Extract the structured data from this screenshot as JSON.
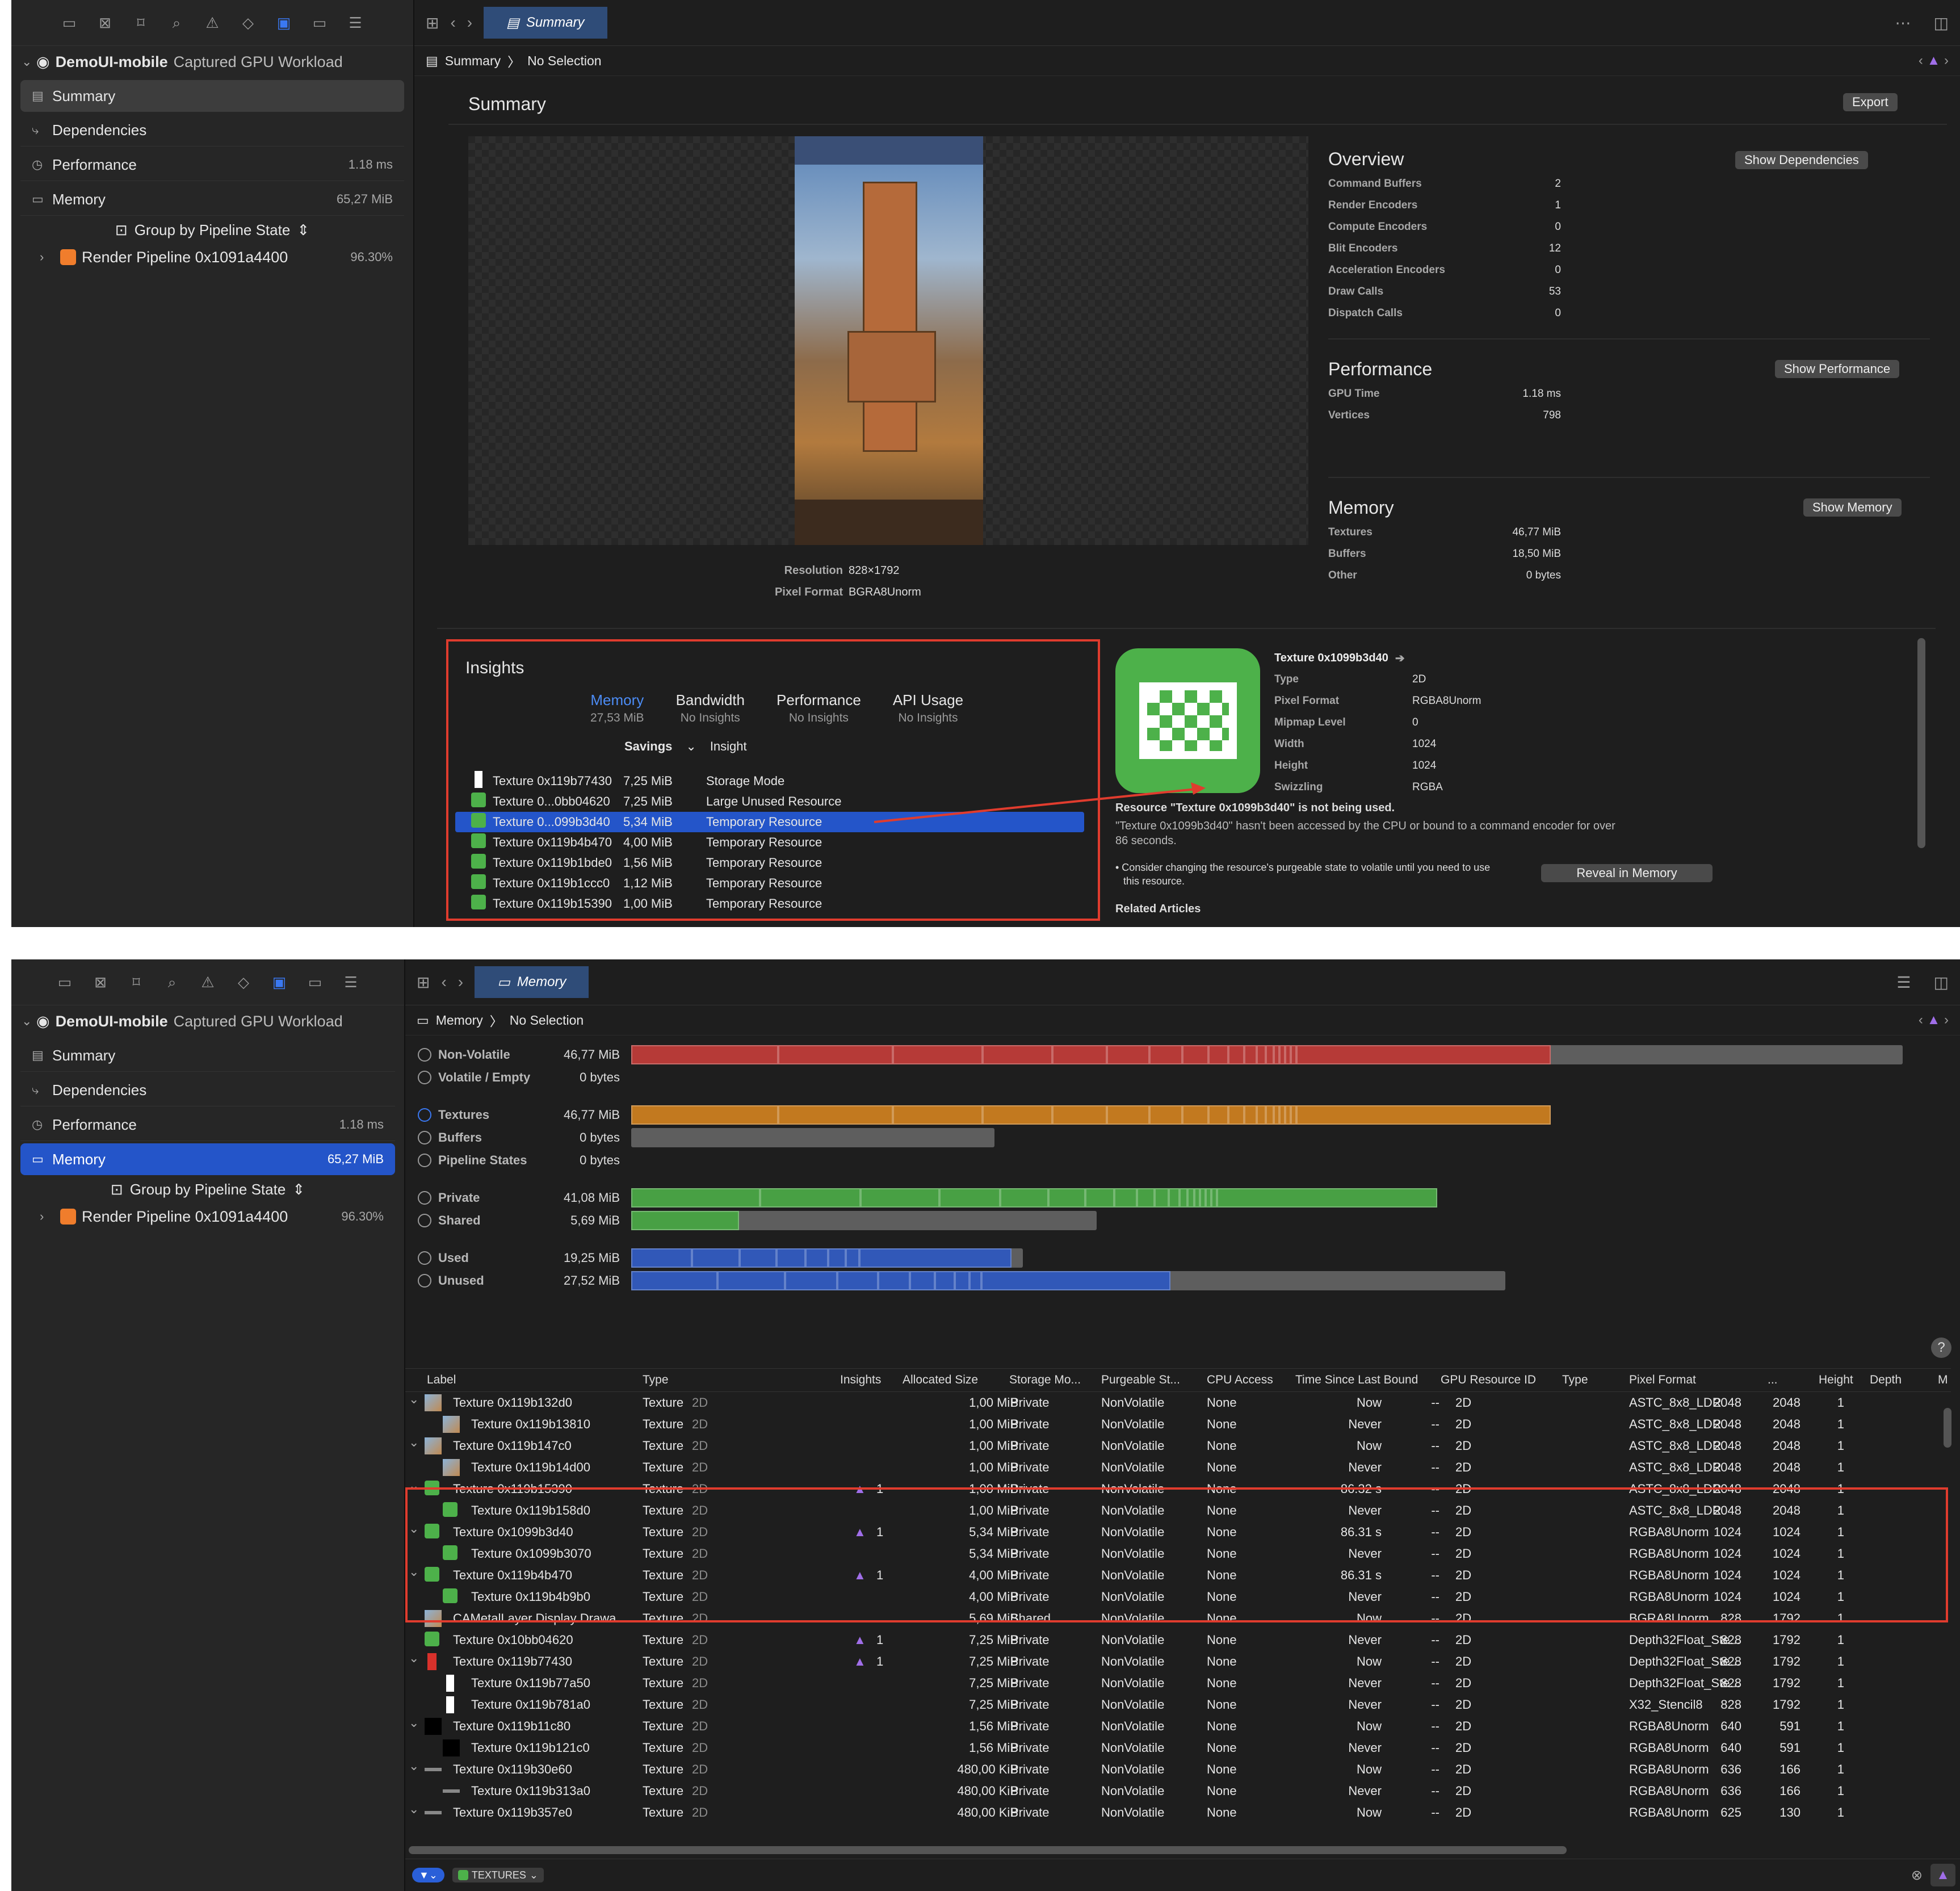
{
  "sidebar": {
    "toolbar_icons": [
      "folder-icon",
      "x-square-icon",
      "bookmark-icon",
      "search-icon",
      "warning-icon",
      "diamond-icon",
      "gpu-icon",
      "rectangle-icon",
      "list-icon"
    ],
    "app_name": "DemoUI-mobile",
    "app_sub": "Captured GPU Workload",
    "items": [
      {
        "label": "Summary",
        "value": ""
      },
      {
        "label": "Dependencies",
        "value": ""
      },
      {
        "label": "Performance",
        "value": "1.18 ms"
      },
      {
        "label": "Memory",
        "value": "65,27 MiB"
      }
    ],
    "group_label": "Group by Pipeline State",
    "pipeline_label": "Render Pipeline 0x1091a4400",
    "pipeline_value": "96.30%"
  },
  "top": {
    "tab_label": "Summary",
    "crumb_root": "Summary",
    "crumb_sel": "No Selection",
    "title": "Summary",
    "export": "Export",
    "resolution_k": "Resolution",
    "resolution_v": "828×1792",
    "pixelformat_k": "Pixel Format",
    "pixelformat_v": "BGRA8Unorm",
    "overview": {
      "title": "Overview",
      "button": "Show Dependencies",
      "rows": [
        {
          "k": "Command Buffers",
          "v": "2"
        },
        {
          "k": "Render Encoders",
          "v": "1"
        },
        {
          "k": "Compute Encoders",
          "v": "0"
        },
        {
          "k": "Blit Encoders",
          "v": "12"
        },
        {
          "k": "Acceleration Encoders",
          "v": "0"
        },
        {
          "k": "Draw Calls",
          "v": "53"
        },
        {
          "k": "Dispatch Calls",
          "v": "0"
        }
      ]
    },
    "performance": {
      "title": "Performance",
      "button": "Show Performance",
      "rows": [
        {
          "k": "GPU Time",
          "v": "1.18 ms"
        },
        {
          "k": "Vertices",
          "v": "798"
        }
      ]
    },
    "memory": {
      "title": "Memory",
      "button": "Show Memory",
      "rows": [
        {
          "k": "Textures",
          "v": "46,77 MiB"
        },
        {
          "k": "Buffers",
          "v": "18,50 MiB"
        },
        {
          "k": "Other",
          "v": "0 bytes"
        }
      ]
    },
    "insights": {
      "title": "Insights",
      "tabs": [
        {
          "name": "Memory",
          "sub": "27,53 MiB"
        },
        {
          "name": "Bandwidth",
          "sub": "No Insights"
        },
        {
          "name": "Performance",
          "sub": "No Insights"
        },
        {
          "name": "API Usage",
          "sub": "No Insights"
        }
      ],
      "col_savings": "Savings",
      "col_insight": "Insight",
      "rows": [
        {
          "icon": "white",
          "name": "Texture 0x119b77430",
          "size": "7,25 MiB",
          "insight": "Storage Mode"
        },
        {
          "icon": "green",
          "name": "Texture 0...0bb04620",
          "size": "7,25 MiB",
          "insight": "Large Unused Resource"
        },
        {
          "icon": "green",
          "name": "Texture 0...099b3d40",
          "size": "5,34 MiB",
          "insight": "Temporary Resource"
        },
        {
          "icon": "green",
          "name": "Texture 0x119b4b470",
          "size": "4,00 MiB",
          "insight": "Temporary Resource"
        },
        {
          "icon": "green",
          "name": "Texture 0x119b1bde0",
          "size": "1,56 MiB",
          "insight": "Temporary Resource"
        },
        {
          "icon": "green",
          "name": "Texture 0x119b1ccc0",
          "size": "1,12 MiB",
          "insight": "Temporary Resource"
        },
        {
          "icon": "green",
          "name": "Texture 0x119b15390",
          "size": "1,00 MiB",
          "insight": "Temporary Resource"
        }
      ]
    },
    "detail": {
      "title": "Texture 0x1099b3d40",
      "rows": [
        {
          "k": "Type",
          "v": "2D"
        },
        {
          "k": "Pixel Format",
          "v": "RGBA8Unorm"
        },
        {
          "k": "Mipmap Level",
          "v": "0"
        },
        {
          "k": "Width",
          "v": "1024"
        },
        {
          "k": "Height",
          "v": "1024"
        },
        {
          "k": "Swizzling",
          "v": "RGBA"
        }
      ],
      "headline": "Resource \"Texture 0x1099b3d40\" is not being used.",
      "desc1": "\"Texture 0x1099b3d40\" hasn't been accessed by the CPU or bound to a command encoder for over",
      "desc2": "86 seconds.",
      "tip1": "• Consider changing the resource's purgeable state to volatile until you need to use",
      "tip2": "this resource.",
      "reveal": "Reveal in Memory",
      "related": "Related Articles"
    }
  },
  "bottom": {
    "tab_label": "Memory",
    "crumb_root": "Memory",
    "crumb_sel": "No Selection",
    "bars": [
      {
        "label": "Non-Volatile",
        "value": "46,77 MiB"
      },
      {
        "label": "Volatile / Empty",
        "value": "0 bytes"
      },
      {
        "label": "Textures",
        "value": "46,77 MiB"
      },
      {
        "label": "Buffers",
        "value": "0 bytes"
      },
      {
        "label": "Pipeline States",
        "value": "0 bytes"
      },
      {
        "label": "Private",
        "value": "41,08 MiB"
      },
      {
        "label": "Shared",
        "value": "5,69 MiB"
      },
      {
        "label": "Used",
        "value": "19,25 MiB"
      },
      {
        "label": "Unused",
        "value": "27,52 MiB"
      }
    ],
    "help": "?",
    "columns": [
      "Label",
      "Type",
      "Insights",
      "Allocated Size",
      "Storage Mo...",
      "Purgeable St...",
      "CPU Access",
      "Time Since Last Bound",
      "GPU Resource ID",
      "Type",
      "Pixel Format",
      "...",
      "Height",
      "Depth",
      "M"
    ],
    "rows": [
      {
        "lvl": 0,
        "exp": true,
        "icon": "photo",
        "label": "Texture 0x119b132d0",
        "type": "Texture",
        "type2": "2D",
        "ins": "",
        "size": "1,00 MiB",
        "storage": "Private",
        "purg": "NonVolatile",
        "cpu": "None",
        "tslb": "Now",
        "gid": "--",
        "t": "2D",
        "fmt": "ASTC_8x8_LDR",
        "w": "2048",
        "h": "2048",
        "d": "1"
      },
      {
        "lvl": 1,
        "exp": false,
        "icon": "photo",
        "label": "Texture 0x119b13810",
        "type": "Texture",
        "type2": "2D",
        "ins": "",
        "size": "1,00 MiB",
        "storage": "Private",
        "purg": "NonVolatile",
        "cpu": "None",
        "tslb": "Never",
        "gid": "--",
        "t": "2D",
        "fmt": "ASTC_8x8_LDR",
        "w": "2048",
        "h": "2048",
        "d": "1"
      },
      {
        "lvl": 0,
        "exp": true,
        "icon": "photo",
        "label": "Texture 0x119b147c0",
        "type": "Texture",
        "type2": "2D",
        "ins": "",
        "size": "1,00 MiB",
        "storage": "Private",
        "purg": "NonVolatile",
        "cpu": "None",
        "tslb": "Now",
        "gid": "--",
        "t": "2D",
        "fmt": "ASTC_8x8_LDR",
        "w": "2048",
        "h": "2048",
        "d": "1"
      },
      {
        "lvl": 1,
        "exp": false,
        "icon": "photo",
        "label": "Texture 0x119b14d00",
        "type": "Texture",
        "type2": "2D",
        "ins": "",
        "size": "1,00 MiB",
        "storage": "Private",
        "purg": "NonVolatile",
        "cpu": "None",
        "tslb": "Never",
        "gid": "--",
        "t": "2D",
        "fmt": "ASTC_8x8_LDR",
        "w": "2048",
        "h": "2048",
        "d": "1"
      },
      {
        "lvl": 0,
        "exp": true,
        "icon": "green",
        "label": "Texture 0x119b15390",
        "type": "Texture",
        "type2": "2D",
        "ins": "1",
        "size": "1,00 MiB",
        "storage": "Private",
        "purg": "NonVolatile",
        "cpu": "None",
        "tslb": "86.32 s",
        "gid": "--",
        "t": "2D",
        "fmt": "ASTC_8x8_LDR",
        "w": "2048",
        "h": "2048",
        "d": "1"
      },
      {
        "lvl": 1,
        "exp": false,
        "icon": "green",
        "label": "Texture 0x119b158d0",
        "type": "Texture",
        "type2": "2D",
        "ins": "",
        "size": "1,00 MiB",
        "storage": "Private",
        "purg": "NonVolatile",
        "cpu": "None",
        "tslb": "Never",
        "gid": "--",
        "t": "2D",
        "fmt": "ASTC_8x8_LDR",
        "w": "2048",
        "h": "2048",
        "d": "1"
      },
      {
        "lvl": 0,
        "exp": true,
        "icon": "green",
        "label": "Texture 0x1099b3d40",
        "type": "Texture",
        "type2": "2D",
        "ins": "1",
        "size": "5,34 MiB",
        "storage": "Private",
        "purg": "NonVolatile",
        "cpu": "None",
        "tslb": "86.31 s",
        "gid": "--",
        "t": "2D",
        "fmt": "RGBA8Unorm",
        "w": "1024",
        "h": "1024",
        "d": "1"
      },
      {
        "lvl": 1,
        "exp": false,
        "icon": "green",
        "label": "Texture 0x1099b3070",
        "type": "Texture",
        "type2": "2D",
        "ins": "",
        "size": "5,34 MiB",
        "storage": "Private",
        "purg": "NonVolatile",
        "cpu": "None",
        "tslb": "Never",
        "gid": "--",
        "t": "2D",
        "fmt": "RGBA8Unorm",
        "w": "1024",
        "h": "1024",
        "d": "1"
      },
      {
        "lvl": 0,
        "exp": true,
        "icon": "green",
        "label": "Texture 0x119b4b470",
        "type": "Texture",
        "type2": "2D",
        "ins": "1",
        "size": "4,00 MiB",
        "storage": "Private",
        "purg": "NonVolatile",
        "cpu": "None",
        "tslb": "86.31 s",
        "gid": "--",
        "t": "2D",
        "fmt": "RGBA8Unorm",
        "w": "1024",
        "h": "1024",
        "d": "1"
      },
      {
        "lvl": 1,
        "exp": false,
        "icon": "green",
        "label": "Texture 0x119b4b9b0",
        "type": "Texture",
        "type2": "2D",
        "ins": "",
        "size": "4,00 MiB",
        "storage": "Private",
        "purg": "NonVolatile",
        "cpu": "None",
        "tslb": "Never",
        "gid": "--",
        "t": "2D",
        "fmt": "RGBA8Unorm",
        "w": "1024",
        "h": "1024",
        "d": "1"
      },
      {
        "lvl": 0,
        "exp": false,
        "icon": "photo",
        "label": "CAMetalLayer Display Drawa...",
        "type": "Texture",
        "type2": "2D",
        "ins": "",
        "size": "5,69 MiB",
        "storage": "Shared",
        "purg": "NonVolatile",
        "cpu": "None",
        "tslb": "Now",
        "gid": "--",
        "t": "2D",
        "fmt": "BGRA8Unorm",
        "w": "828",
        "h": "1792",
        "d": "1"
      },
      {
        "lvl": 0,
        "exp": false,
        "icon": "green",
        "label": "Texture 0x10bb04620",
        "type": "Texture",
        "type2": "2D",
        "ins": "1",
        "size": "7,25 MiB",
        "storage": "Private",
        "purg": "NonVolatile",
        "cpu": "None",
        "tslb": "Never",
        "gid": "--",
        "t": "2D",
        "fmt": "Depth32Float_Ste...",
        "w": "828",
        "h": "1792",
        "d": "1"
      },
      {
        "lvl": 0,
        "exp": true,
        "icon": "red",
        "label": "Texture 0x119b77430",
        "type": "Texture",
        "type2": "2D",
        "ins": "1",
        "size": "7,25 MiB",
        "storage": "Private",
        "purg": "NonVolatile",
        "cpu": "None",
        "tslb": "Now",
        "gid": "--",
        "t": "2D",
        "fmt": "Depth32Float_Ste...",
        "w": "828",
        "h": "1792",
        "d": "1"
      },
      {
        "lvl": 1,
        "exp": false,
        "icon": "white",
        "label": "Texture 0x119b77a50",
        "type": "Texture",
        "type2": "2D",
        "ins": "",
        "size": "7,25 MiB",
        "storage": "Private",
        "purg": "NonVolatile",
        "cpu": "None",
        "tslb": "Never",
        "gid": "--",
        "t": "2D",
        "fmt": "Depth32Float_Ste...",
        "w": "828",
        "h": "1792",
        "d": "1"
      },
      {
        "lvl": 1,
        "exp": false,
        "icon": "white",
        "label": "Texture 0x119b781a0",
        "type": "Texture",
        "type2": "2D",
        "ins": "",
        "size": "7,25 MiB",
        "storage": "Private",
        "purg": "NonVolatile",
        "cpu": "None",
        "tslb": "Never",
        "gid": "--",
        "t": "2D",
        "fmt": "X32_Stencil8",
        "w": "828",
        "h": "1792",
        "d": "1"
      },
      {
        "lvl": 0,
        "exp": true,
        "icon": "black",
        "label": "Texture 0x119b11c80",
        "type": "Texture",
        "type2": "2D",
        "ins": "",
        "size": "1,56 MiB",
        "storage": "Private",
        "purg": "NonVolatile",
        "cpu": "None",
        "tslb": "Now",
        "gid": "--",
        "t": "2D",
        "fmt": "RGBA8Unorm",
        "w": "640",
        "h": "591",
        "d": "1"
      },
      {
        "lvl": 1,
        "exp": false,
        "icon": "black",
        "label": "Texture 0x119b121c0",
        "type": "Texture",
        "type2": "2D",
        "ins": "",
        "size": "1,56 MiB",
        "storage": "Private",
        "purg": "NonVolatile",
        "cpu": "None",
        "tslb": "Never",
        "gid": "--",
        "t": "2D",
        "fmt": "RGBA8Unorm",
        "w": "640",
        "h": "591",
        "d": "1"
      },
      {
        "lvl": 0,
        "exp": true,
        "icon": "strip",
        "label": "Texture 0x119b30e60",
        "type": "Texture",
        "type2": "2D",
        "ins": "",
        "size": "480,00 KiB",
        "storage": "Private",
        "purg": "NonVolatile",
        "cpu": "None",
        "tslb": "Now",
        "gid": "--",
        "t": "2D",
        "fmt": "RGBA8Unorm",
        "w": "636",
        "h": "166",
        "d": "1"
      },
      {
        "lvl": 1,
        "exp": false,
        "icon": "strip",
        "label": "Texture 0x119b313a0",
        "type": "Texture",
        "type2": "2D",
        "ins": "",
        "size": "480,00 KiB",
        "storage": "Private",
        "purg": "NonVolatile",
        "cpu": "None",
        "tslb": "Never",
        "gid": "--",
        "t": "2D",
        "fmt": "RGBA8Unorm",
        "w": "636",
        "h": "166",
        "d": "1"
      },
      {
        "lvl": 0,
        "exp": true,
        "icon": "strip",
        "label": "Texture 0x119b357e0",
        "type": "Texture",
        "type2": "2D",
        "ins": "",
        "size": "480,00 KiB",
        "storage": "Private",
        "purg": "NonVolatile",
        "cpu": "None",
        "tslb": "Now",
        "gid": "--",
        "t": "2D",
        "fmt": "RGBA8Unorm",
        "w": "625",
        "h": "130",
        "d": "1"
      }
    ],
    "filter_label": "TEXTURES"
  },
  "colors": {
    "accent": "#2455c9",
    "red_bar": "#b63a37",
    "orange_bar": "#c2791f",
    "green_bar": "#48a044",
    "blue_bar": "#3158b8",
    "grey_bar": "#5e5e5e",
    "annotation": "#e03c2e",
    "texture_green": "#4db14a"
  }
}
